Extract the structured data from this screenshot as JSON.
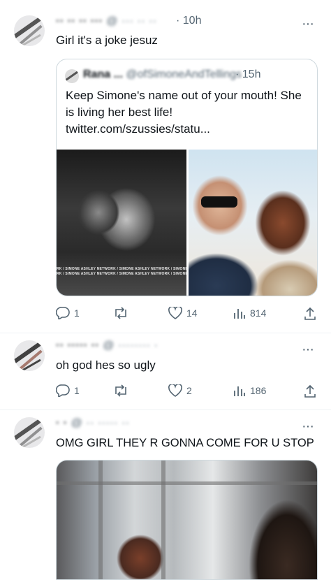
{
  "tweets": [
    {
      "time": "· 10h",
      "text": "Girl it's a joke jesuz",
      "quote": {
        "time": "· 15h",
        "text_lines": [
          "Keep Simone's name out of your mouth! She",
          "is living her best life!",
          "twitter.com/szussies/statu..."
        ],
        "watermark_1": "RK / SIMONE ASHLEY NETWORK / SIMONE ASHLEY NETWORK / SIMONE /",
        "watermark_2": "RK / SIMONE ASHLEY NETWORK / SIMONE ASHLEY NETWORK / SIMONE /"
      },
      "stats": {
        "replies": "1",
        "reposts": "",
        "likes": "14",
        "views": "814"
      }
    },
    {
      "time": "· 8h",
      "text": "oh god hes so ugly",
      "stats": {
        "replies": "1",
        "reposts": "",
        "likes": "2",
        "views": "186"
      }
    },
    {
      "time": "· 8h",
      "text": "OMG GIRL THEY R GONNA COME FOR U STOP"
    }
  ],
  "more_label": "···",
  "icons": [
    "reply-icon",
    "repost-icon",
    "like-icon",
    "views-icon",
    "share-icon",
    "more-icon"
  ]
}
